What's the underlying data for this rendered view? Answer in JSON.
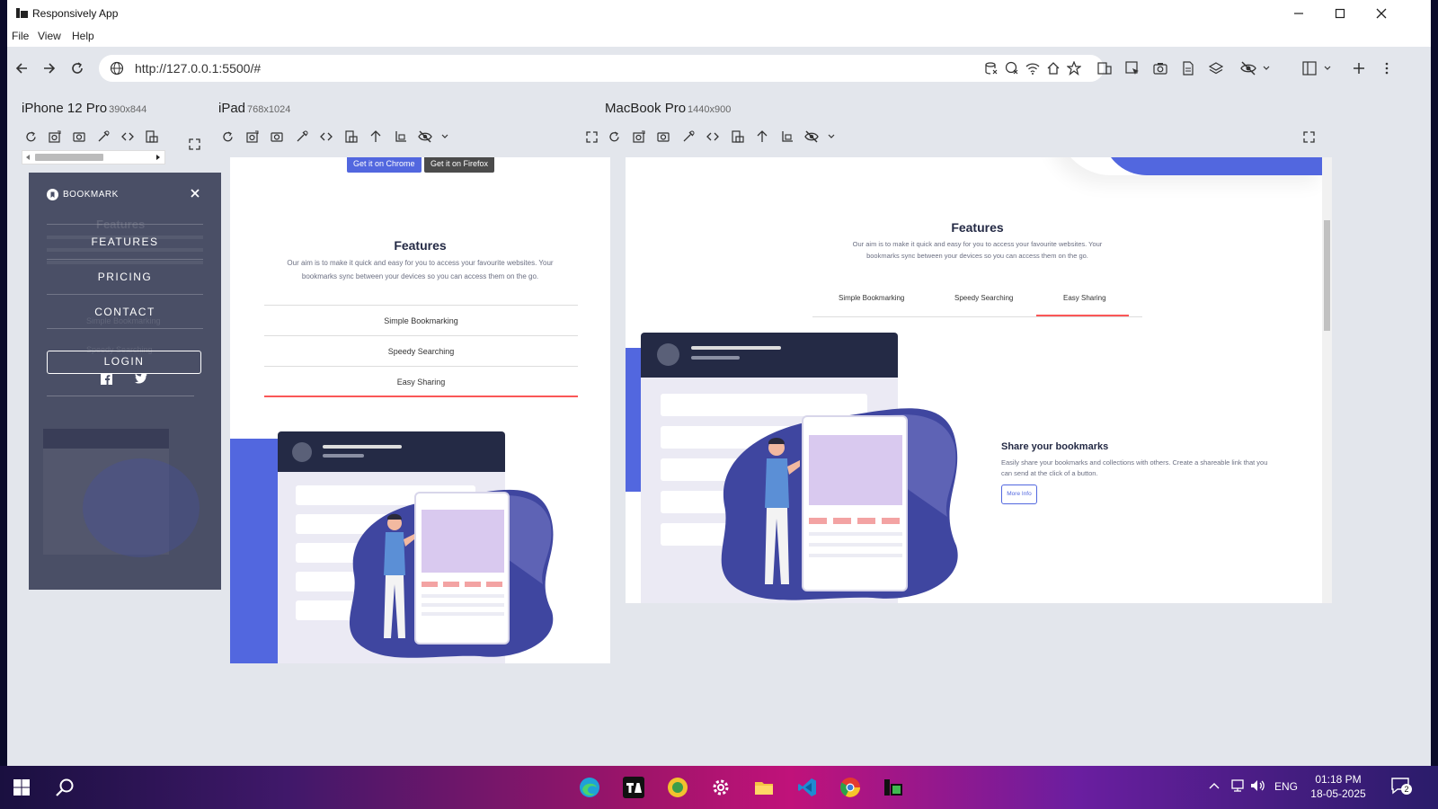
{
  "window": {
    "title": "Responsively App"
  },
  "menu": [
    "File",
    "View",
    "Help"
  ],
  "address": {
    "url": "http://127.0.0.1:5500/#"
  },
  "devices": [
    {
      "name": "iPhone 12 Pro",
      "size": "390x844"
    },
    {
      "name": "iPad",
      "size": "768x1024"
    },
    {
      "name": "MacBook Pro",
      "size": "1440x900"
    }
  ],
  "mobile_menu": {
    "brand": "BOOKMARK",
    "items": [
      "FEATURES",
      "PRICING",
      "CONTACT"
    ],
    "login": "LOGIN",
    "ghost": {
      "title": "Features",
      "tab1": "Simple Bookmarking",
      "tab2": "Speedy Searching"
    }
  },
  "site": {
    "btn_chrome": "Get it on Chrome",
    "btn_firefox": "Get it on Firefox",
    "features_title": "Features",
    "features_desc": "Our aim is to make it quick and easy for you to access your favourite websites. Your bookmarks sync between your devices so you can access them on the go.",
    "tabs": [
      "Simple Bookmarking",
      "Speedy Searching",
      "Easy Sharing"
    ],
    "active_tab": "Easy Sharing",
    "share_title": "Share your bookmarks",
    "share_desc": "Easily share your bookmarks and collections with others. Create a shareable link that you can send at the click of a button.",
    "more_info": "More Info"
  },
  "colors": {
    "primary": "#5267df",
    "danger": "#fa5757",
    "navy": "#242a45",
    "panel": "#4a4f66"
  },
  "taskbar": {
    "language": "ENG",
    "time": "01:18 PM",
    "date": "18-05-2025",
    "notifications": "2"
  }
}
